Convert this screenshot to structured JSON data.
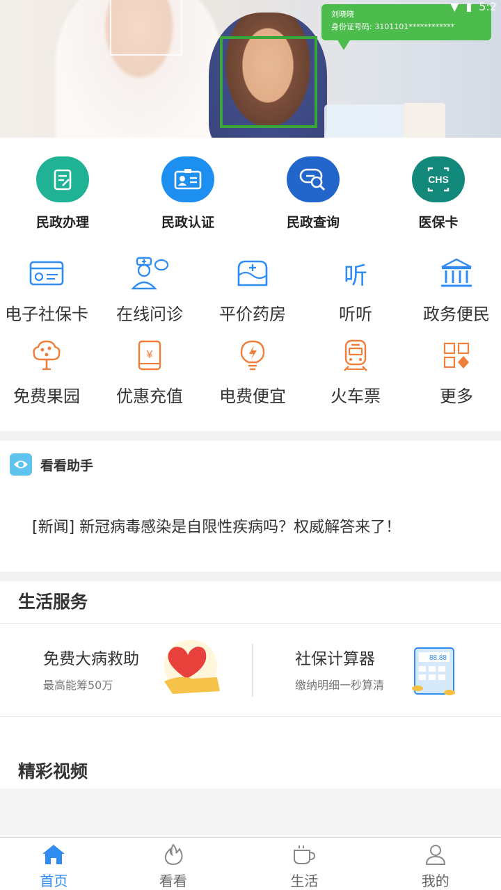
{
  "banner": {
    "bubble_name": "刘晓晓",
    "bubble_id": "身份证号码: 3101101************",
    "status_time": "5:2"
  },
  "top_services": [
    {
      "label": "民政办理",
      "icon": "document-edit-icon",
      "color": "#1fb295"
    },
    {
      "label": "民政认证",
      "icon": "id-card-icon",
      "color": "#1d8ff0"
    },
    {
      "label": "民政查询",
      "icon": "search-card-icon",
      "color": "#2266cc"
    },
    {
      "label": "医保卡",
      "icon": "chs-icon",
      "color": "#12897a",
      "text": "CHS"
    }
  ],
  "grid_row1": [
    {
      "label": "电子社保卡",
      "icon": "social-card-icon"
    },
    {
      "label": "在线问诊",
      "icon": "doctor-chat-icon"
    },
    {
      "label": "平价药房",
      "icon": "pharmacy-icon"
    },
    {
      "label": "听听",
      "icon": "listen-icon",
      "text": "听"
    },
    {
      "label": "政务便民",
      "icon": "government-building-icon"
    }
  ],
  "grid_row2": [
    {
      "label": "免费果园",
      "icon": "fruit-tree-icon"
    },
    {
      "label": "优惠充值",
      "icon": "phone-recharge-icon",
      "text": "¥"
    },
    {
      "label": "电费便宜",
      "icon": "electric-bulb-icon"
    },
    {
      "label": "火车票",
      "icon": "train-icon"
    },
    {
      "label": "更多",
      "icon": "more-grid-icon"
    }
  ],
  "colors": {
    "blue": "#2f8cf2",
    "orange": "#ef7e3a"
  },
  "assistant": {
    "title": "看看助手",
    "news": "[新闻]  新冠病毒感染是自限性疾病吗？权威解答来了！"
  },
  "life": {
    "title": "生活服务",
    "cards": [
      {
        "title": "免费大病救助",
        "subtitle": "最高能筹50万",
        "icon": "heart-hand-icon"
      },
      {
        "title": "社保计算器",
        "subtitle": "缴纳明细一秒算清",
        "icon": "calculator-icon",
        "calc_display": "88.88"
      }
    ]
  },
  "video": {
    "title": "精彩视频"
  },
  "nav": [
    {
      "label": "首页",
      "icon": "home-icon",
      "active": true
    },
    {
      "label": "看看",
      "icon": "flame-icon",
      "active": false
    },
    {
      "label": "生活",
      "icon": "coffee-cup-icon",
      "active": false
    },
    {
      "label": "我的",
      "icon": "user-icon",
      "active": false
    }
  ]
}
